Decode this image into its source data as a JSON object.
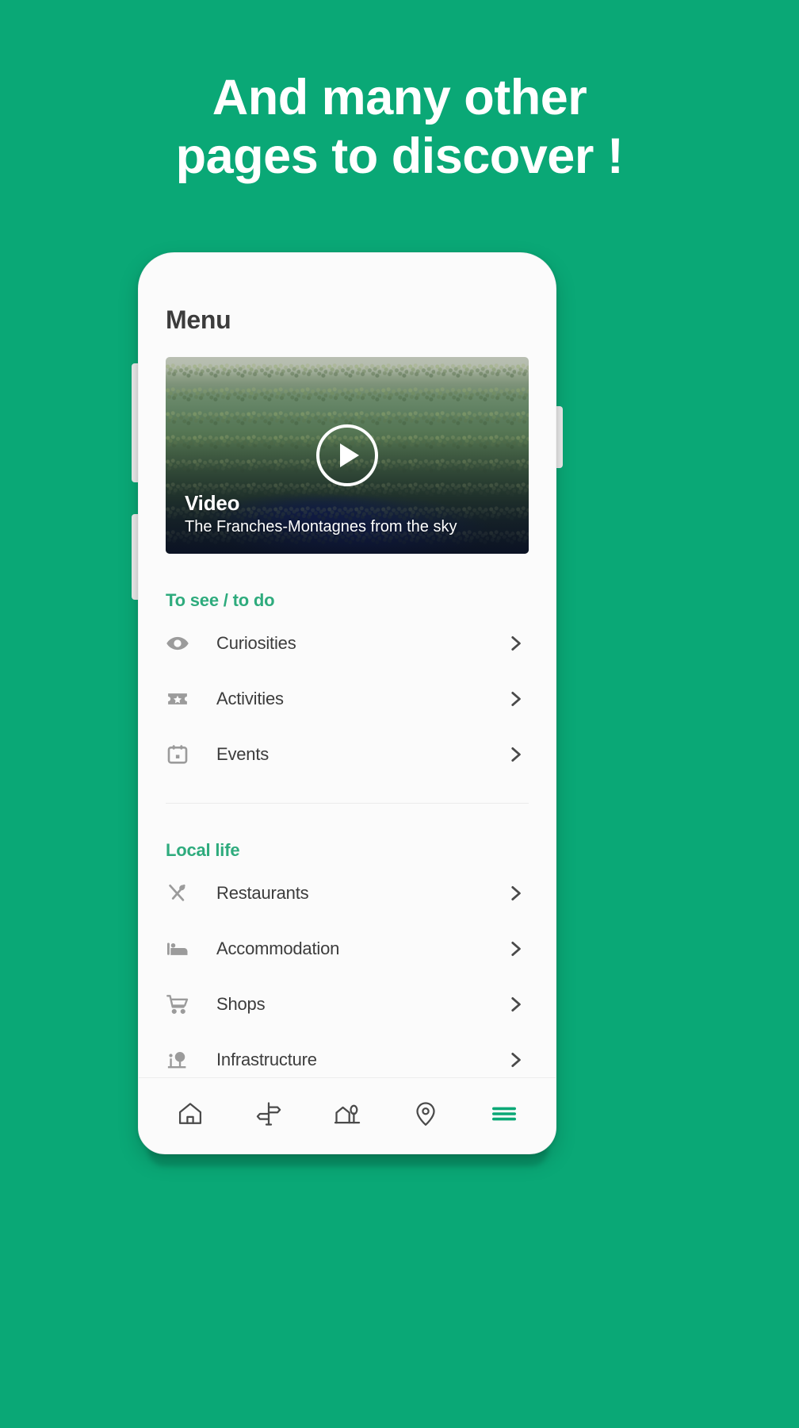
{
  "promo": {
    "headline_line1": "And many other",
    "headline_line2": "pages to discover !",
    "background_color": "#0AA876",
    "headline_color": "#FFFFFF"
  },
  "phone": {
    "screen": {
      "title": "Menu",
      "video_card": {
        "badge_title": "Video",
        "subtitle": "The Franches-Montagnes from the sky",
        "play_icon": "play-icon"
      },
      "sections": [
        {
          "title": "To see / to do",
          "accent_color": "#2EAB7D",
          "items": [
            {
              "label": "Curiosities",
              "icon": "eye-icon",
              "chevron": "chevron-right-icon"
            },
            {
              "label": "Activities",
              "icon": "ticket-star-icon",
              "chevron": "chevron-right-icon"
            },
            {
              "label": "Events",
              "icon": "calendar-icon",
              "chevron": "chevron-right-icon"
            }
          ]
        },
        {
          "title": "Local life",
          "accent_color": "#2EAB7D",
          "items": [
            {
              "label": "Restaurants",
              "icon": "cutlery-icon",
              "chevron": "chevron-right-icon"
            },
            {
              "label": "Accommodation",
              "icon": "bed-icon",
              "chevron": "chevron-right-icon"
            },
            {
              "label": "Shops",
              "icon": "shopping-cart-icon",
              "chevron": "chevron-right-icon"
            },
            {
              "label": "Infrastructure",
              "icon": "park-tree-icon",
              "chevron": "chevron-right-icon"
            }
          ]
        }
      ],
      "bottom_nav": [
        {
          "name": "home",
          "icon": "home-icon",
          "active": false
        },
        {
          "name": "directions",
          "icon": "signpost-icon",
          "active": false
        },
        {
          "name": "village",
          "icon": "village-icon",
          "active": false
        },
        {
          "name": "map",
          "icon": "location-pin-icon",
          "active": false
        },
        {
          "name": "menu",
          "icon": "hamburger-menu-icon",
          "active": true
        }
      ],
      "colors": {
        "text_primary": "#3C3C3C",
        "icon_grey": "#9B9B9B",
        "nav_active": "#0AA876"
      }
    }
  }
}
